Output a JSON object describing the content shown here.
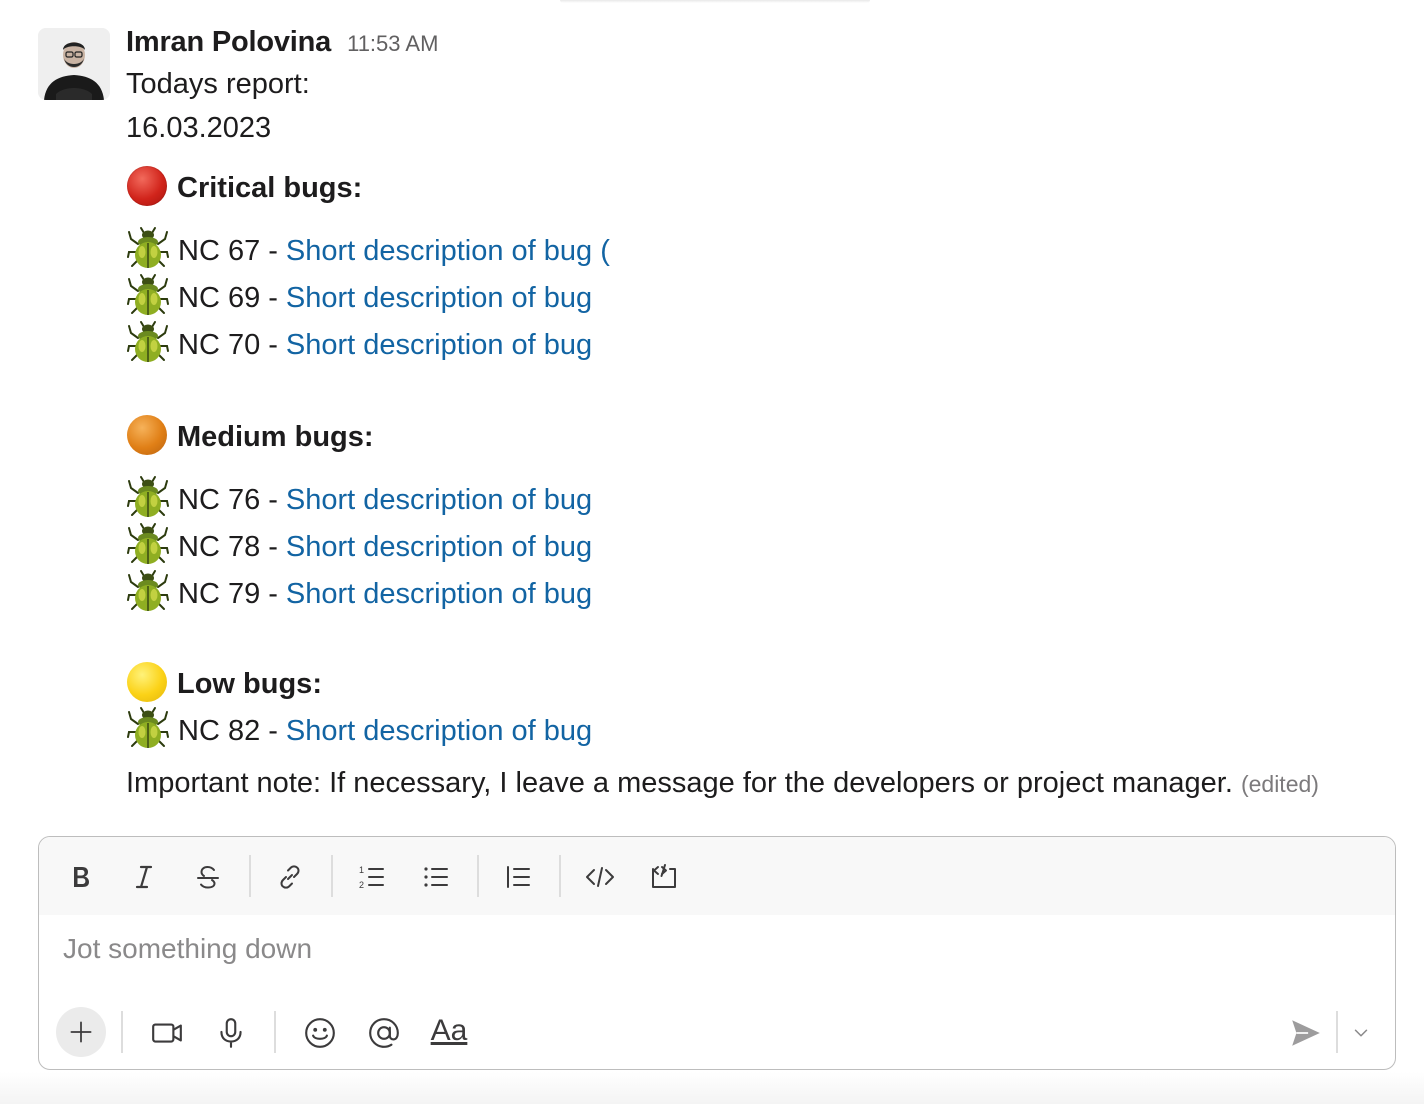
{
  "message": {
    "author": "Imran Polovina",
    "time": "11:53 AM",
    "intro": "Todays report:",
    "date": "16.03.2023",
    "sections": [
      {
        "title": "Critical bugs:",
        "color_icon": "red-circle-icon",
        "color": "#d1241b",
        "bugs": [
          {
            "id": "NC 67",
            "sep": "-",
            "link": "Short description of bug ("
          },
          {
            "id": "NC 69",
            "sep": "-",
            "link": "Short description of bug"
          },
          {
            "id": "NC 70",
            "sep": "-",
            "link": "Short description of bug"
          }
        ]
      },
      {
        "title": "Medium bugs:",
        "color_icon": "orange-circle-icon",
        "color": "#e07f16",
        "bugs": [
          {
            "id": "NC 76",
            "sep": "-",
            "link": "Short description of bug"
          },
          {
            "id": "NC 78",
            "sep": "-",
            "link": "Short description of bug"
          },
          {
            "id": "NC 79",
            "sep": "-",
            "link": "Short description of bug"
          }
        ]
      },
      {
        "title": "Low bugs:",
        "color_icon": "yellow-circle-icon",
        "color": "#fbd217",
        "bugs": [
          {
            "id": "NC 82",
            "sep": "-",
            "link": "Short description of bug"
          }
        ]
      }
    ],
    "note": "Important note: If necessary, I leave a message for the developers or project manager.",
    "edited": "(edited)"
  },
  "composer": {
    "placeholder": "Jot something down",
    "format_aa": "Aa",
    "toolbar_icons": [
      "bold-icon",
      "italic-icon",
      "strikethrough-icon",
      "link-icon",
      "ordered-list-icon",
      "bulleted-list-icon",
      "blockquote-icon",
      "code-icon",
      "code-block-icon"
    ],
    "bottom_icons": [
      "plus-icon",
      "video-icon",
      "microphone-icon",
      "emoji-icon",
      "mention-icon",
      "format-icon",
      "send-icon",
      "chevron-down-icon"
    ]
  },
  "colors": {
    "link": "#1264a3",
    "text": "#1d1c1d",
    "muted": "#616061"
  }
}
